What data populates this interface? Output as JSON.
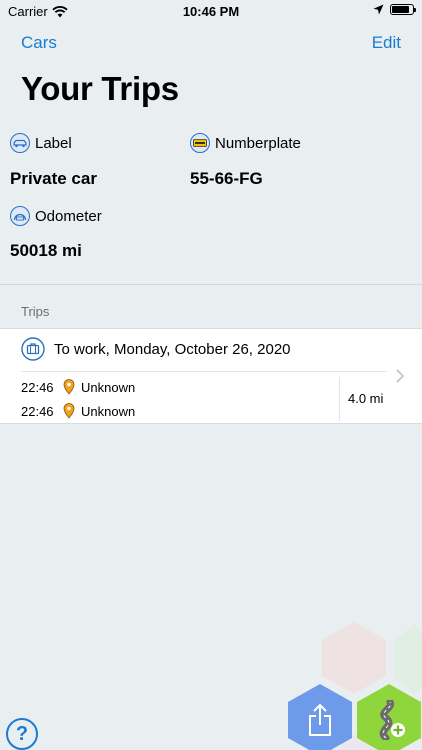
{
  "status_bar": {
    "carrier": "Carrier",
    "time": "10:46 PM"
  },
  "nav": {
    "back_label": "Cars",
    "edit_label": "Edit"
  },
  "title": "Your Trips",
  "car": {
    "label_caption": "Label",
    "label_value": "Private car",
    "numberplate_caption": "Numberplate",
    "numberplate_value": "55-66-FG",
    "odometer_caption": "Odometer",
    "odometer_value": "50018 mi"
  },
  "trips_section": {
    "header": "Trips",
    "items": [
      {
        "title": "To work, Monday, October 26, 2020",
        "start_time": "22:46",
        "start_location": "Unknown",
        "end_time": "22:46",
        "end_location": "Unknown",
        "distance": "4.0 mi"
      }
    ]
  },
  "help": {
    "label": "?"
  },
  "colors": {
    "accent": "#1b7bd2",
    "share_button": "#6d9bea",
    "add_trip_button": "#8ed63c",
    "background": "#e9eff0"
  },
  "icons": {
    "label": "car-icon",
    "numberplate": "license-plate-icon",
    "odometer": "odometer-icon",
    "trip_purpose": "briefcase-icon",
    "location": "location-pin-icon",
    "share": "share-icon",
    "add_trip": "add-trip-icon"
  }
}
